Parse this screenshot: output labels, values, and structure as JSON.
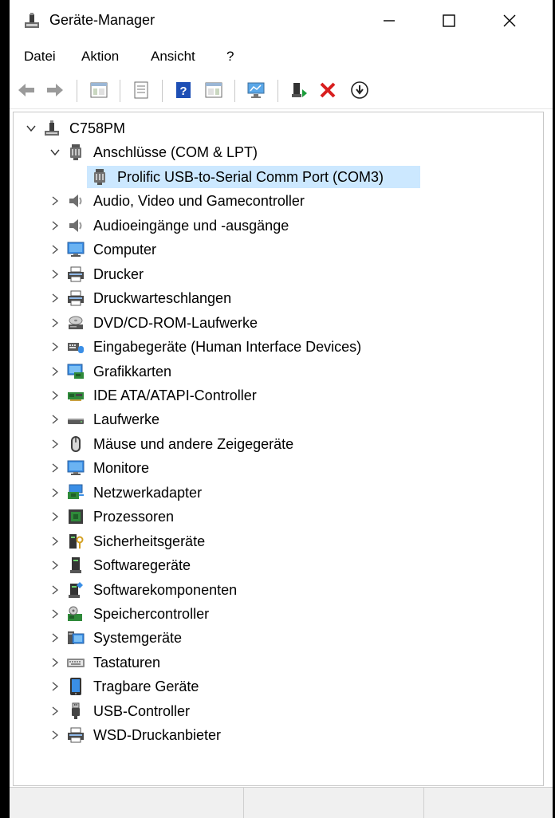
{
  "window": {
    "title": "Geräte-Manager"
  },
  "menu": [
    {
      "id": "datei",
      "label": "Datei"
    },
    {
      "id": "aktion",
      "label": "Aktion"
    },
    {
      "id": "ansicht",
      "label": "Ansicht"
    },
    {
      "id": "help",
      "label": "?"
    }
  ],
  "toolbar": [
    {
      "icon": "back-arrow-icon"
    },
    {
      "icon": "forward-arrow-icon"
    },
    {
      "icon": "show-hide-console-tree-icon"
    },
    {
      "icon": "properties-icon"
    },
    {
      "icon": "help-icon"
    },
    {
      "icon": "action-pane-icon"
    },
    {
      "icon": "scan-hardware-icon"
    },
    {
      "icon": "update-driver-icon"
    },
    {
      "icon": "uninstall-device-icon"
    },
    {
      "icon": "download-circle-icon"
    }
  ],
  "tree": {
    "root": {
      "label": "C758PM",
      "icon": "computer-root-icon",
      "expanded": true
    },
    "categories": [
      {
        "label": "Anschlüsse (COM & LPT)",
        "icon": "port-icon",
        "expanded": true,
        "children": [
          {
            "label": "Prolific USB-to-Serial Comm Port (COM3)",
            "icon": "port-icon",
            "selected": true
          }
        ]
      },
      {
        "label": "Audio, Video und Gamecontroller",
        "icon": "speaker-icon"
      },
      {
        "label": "Audioeingänge und -ausgänge",
        "icon": "speaker-icon"
      },
      {
        "label": "Computer",
        "icon": "monitor-icon"
      },
      {
        "label": "Drucker",
        "icon": "printer-icon"
      },
      {
        "label": "Druckwarteschlangen",
        "icon": "printer-icon"
      },
      {
        "label": "DVD/CD-ROM-Laufwerke",
        "icon": "disc-drive-icon"
      },
      {
        "label": "Eingabegeräte (Human Interface Devices)",
        "icon": "hid-icon"
      },
      {
        "label": "Grafikkarten",
        "icon": "display-adapter-icon"
      },
      {
        "label": "IDE ATA/ATAPI-Controller",
        "icon": "ide-controller-icon"
      },
      {
        "label": "Laufwerke",
        "icon": "disk-drive-icon"
      },
      {
        "label": "Mäuse und andere Zeigegeräte",
        "icon": "mouse-icon"
      },
      {
        "label": "Monitore",
        "icon": "monitor-icon"
      },
      {
        "label": "Netzwerkadapter",
        "icon": "network-adapter-icon"
      },
      {
        "label": "Prozessoren",
        "icon": "processor-icon"
      },
      {
        "label": "Sicherheitsgeräte",
        "icon": "security-device-icon"
      },
      {
        "label": "Softwaregeräte",
        "icon": "software-device-icon"
      },
      {
        "label": "Softwarekomponenten",
        "icon": "software-component-icon"
      },
      {
        "label": "Speichercontroller",
        "icon": "storage-controller-icon"
      },
      {
        "label": "Systemgeräte",
        "icon": "system-device-icon"
      },
      {
        "label": "Tastaturen",
        "icon": "keyboard-icon"
      },
      {
        "label": "Tragbare Geräte",
        "icon": "portable-device-icon"
      },
      {
        "label": "USB-Controller",
        "icon": "usb-icon"
      },
      {
        "label": "WSD-Druckanbieter",
        "icon": "printer-icon"
      }
    ]
  },
  "colors": {
    "selection": "#cce8ff",
    "accent_blue": "#1e7bd6",
    "delete_red": "#d81e1e"
  }
}
